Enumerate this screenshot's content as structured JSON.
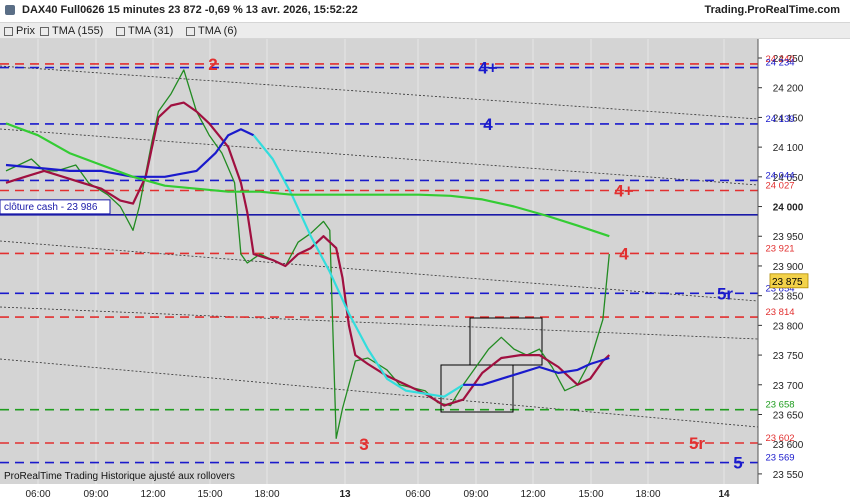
{
  "header": {
    "title": "DAX40 Full0626 15 minutes 23 872 -0,69 % 13 avr. 2026, 15:52:22",
    "brand": "Trading.ProRealTime.com"
  },
  "legend": [
    {
      "label": "Prix",
      "color": "#a0a0a0"
    },
    {
      "label": "TMA (155)",
      "color": "#33cc33"
    },
    {
      "label": "TMA (31)",
      "color": "#1a1acc"
    },
    {
      "label": "TMA (6)",
      "color": "#a01040"
    }
  ],
  "footer_note": "ProRealTime Trading  Historique ajusté aux rollovers",
  "chart_data": {
    "type": "line",
    "yticks": [
      23550,
      23600,
      23650,
      23700,
      23750,
      23800,
      23850,
      23900,
      23950,
      24000,
      24050,
      24100,
      24150,
      24200,
      24250
    ],
    "ylim": [
      23533,
      24282
    ],
    "xticks": [
      "06:00",
      "09:00",
      "12:00",
      "15:00",
      "18:00",
      "13",
      "06:00",
      "09:00",
      "12:00",
      "15:00",
      "18:00",
      "14"
    ],
    "close_value": "23 875",
    "cash_close": {
      "label": "clôture cash -  23 986",
      "value": 23986
    },
    "levels": [
      {
        "value": 24240,
        "label": "24 240",
        "color": "red",
        "tag": "2"
      },
      {
        "value": 24234,
        "label": "24 234",
        "color": "blue",
        "tag": "4+"
      },
      {
        "value": 24139,
        "label": "24 139",
        "color": "blue",
        "tag": "4"
      },
      {
        "value": 24044,
        "label": "24 044",
        "color": "blue",
        "tag": ""
      },
      {
        "value": 24027,
        "label": "24 027",
        "color": "red",
        "tag": "4+"
      },
      {
        "value": 23921,
        "label": "23 921",
        "color": "red",
        "tag": "4"
      },
      {
        "value": 23854,
        "label": "23 854",
        "color": "blue",
        "tag": "5r"
      },
      {
        "value": 23814,
        "label": "23 814",
        "color": "red",
        "tag": ""
      },
      {
        "value": 23658,
        "label": "23 658",
        "color": "green",
        "tag": ""
      },
      {
        "value": 23602,
        "label": "23 602",
        "color": "red",
        "tag": "5r"
      },
      {
        "value": 23569,
        "label": "23 569",
        "color": "blue",
        "tag": "5"
      }
    ],
    "pivots": [
      {
        "tag": "2",
        "value": 24240
      },
      {
        "tag": "3",
        "value": 23600
      }
    ],
    "series": [
      {
        "name": "Prix",
        "color": "#228b22",
        "points": [
          [
            0,
            24060
          ],
          [
            2,
            24070
          ],
          [
            4,
            24080
          ],
          [
            6,
            24060
          ],
          [
            8,
            24060
          ],
          [
            11,
            24070
          ],
          [
            13,
            24040
          ],
          [
            16,
            24020
          ],
          [
            18,
            24000
          ],
          [
            20,
            23960
          ],
          [
            21,
            24000
          ],
          [
            23,
            24110
          ],
          [
            24,
            24160
          ],
          [
            26,
            24190
          ],
          [
            28,
            24230
          ],
          [
            30,
            24160
          ],
          [
            32,
            24120
          ],
          [
            34,
            24090
          ],
          [
            36,
            24040
          ],
          [
            37,
            23920
          ],
          [
            38,
            23905
          ],
          [
            40,
            23920
          ],
          [
            42,
            23910
          ],
          [
            44,
            23900
          ],
          [
            46,
            23940
          ],
          [
            48,
            23955
          ],
          [
            50,
            23975
          ],
          [
            51,
            23960
          ],
          [
            52,
            23610
          ],
          [
            53,
            23660
          ],
          [
            55,
            23740
          ],
          [
            57,
            23745
          ],
          [
            60,
            23725
          ],
          [
            62,
            23700
          ],
          [
            64,
            23695
          ],
          [
            66,
            23690
          ],
          [
            68,
            23670
          ],
          [
            70,
            23665
          ],
          [
            72,
            23700
          ],
          [
            74,
            23730
          ],
          [
            76,
            23760
          ],
          [
            78,
            23780
          ],
          [
            80,
            23760
          ],
          [
            82,
            23750
          ],
          [
            84,
            23760
          ],
          [
            86,
            23730
          ],
          [
            88,
            23690
          ],
          [
            90,
            23700
          ],
          [
            92,
            23740
          ],
          [
            94,
            23810
          ],
          [
            95,
            23920
          ]
        ]
      },
      {
        "name": "TMA (6)",
        "color": "#a01040",
        "points": [
          [
            0,
            24040
          ],
          [
            3,
            24050
          ],
          [
            6,
            24060
          ],
          [
            9,
            24050
          ],
          [
            12,
            24040
          ],
          [
            15,
            24030
          ],
          [
            18,
            24010
          ],
          [
            20,
            24005
          ],
          [
            22,
            24050
          ],
          [
            24,
            24150
          ],
          [
            26,
            24170
          ],
          [
            28,
            24175
          ],
          [
            30,
            24160
          ],
          [
            32,
            24140
          ],
          [
            35,
            24100
          ],
          [
            37,
            24040
          ],
          [
            38,
            23990
          ],
          [
            39,
            23920
          ],
          [
            42,
            23910
          ],
          [
            44,
            23900
          ],
          [
            46,
            23920
          ],
          [
            48,
            23930
          ],
          [
            50,
            23950
          ],
          [
            52,
            23930
          ],
          [
            53,
            23880
          ],
          [
            54,
            23800
          ],
          [
            55,
            23750
          ],
          [
            57,
            23735
          ],
          [
            60,
            23715
          ],
          [
            63,
            23700
          ],
          [
            66,
            23685
          ],
          [
            69,
            23665
          ],
          [
            72,
            23675
          ],
          [
            75,
            23720
          ],
          [
            78,
            23745
          ],
          [
            81,
            23750
          ],
          [
            84,
            23750
          ],
          [
            87,
            23730
          ],
          [
            90,
            23700
          ],
          [
            92,
            23710
          ],
          [
            94,
            23740
          ],
          [
            95,
            23750
          ]
        ]
      },
      {
        "name": "TMA (31)",
        "color": "#1a1acc",
        "points": [
          [
            0,
            24070
          ],
          [
            5,
            24065
          ],
          [
            10,
            24060
          ],
          [
            15,
            24060
          ],
          [
            20,
            24050
          ],
          [
            25,
            24050
          ],
          [
            30,
            24060
          ],
          [
            33,
            24090
          ],
          [
            35,
            24120
          ],
          [
            37,
            24130
          ],
          [
            39,
            24120
          ]
        ]
      },
      {
        "name": "TMA (31) cyan",
        "color": "#33dddd",
        "points": [
          [
            39,
            24120
          ],
          [
            42,
            24080
          ],
          [
            45,
            24020
          ],
          [
            48,
            23950
          ],
          [
            51,
            23890
          ],
          [
            54,
            23820
          ],
          [
            57,
            23760
          ],
          [
            60,
            23710
          ],
          [
            63,
            23690
          ],
          [
            66,
            23685
          ],
          [
            69,
            23680
          ],
          [
            72,
            23700
          ]
        ]
      },
      {
        "name": "TMA (31) blue",
        "color": "#1a1acc",
        "points": [
          [
            72,
            23700
          ],
          [
            75,
            23700
          ],
          [
            78,
            23710
          ],
          [
            81,
            23720
          ],
          [
            84,
            23730
          ],
          [
            87,
            23720
          ],
          [
            90,
            23725
          ],
          [
            92,
            23735
          ],
          [
            95,
            23745
          ]
        ]
      },
      {
        "name": "TMA (155)",
        "color": "#33cc33",
        "points": [
          [
            0,
            24140
          ],
          [
            5,
            24120
          ],
          [
            10,
            24090
          ],
          [
            15,
            24070
          ],
          [
            20,
            24050
          ],
          [
            25,
            24035
          ],
          [
            30,
            24030
          ],
          [
            35,
            24025
          ],
          [
            40,
            24025
          ],
          [
            45,
            24020
          ],
          [
            50,
            24020
          ],
          [
            55,
            24020
          ],
          [
            60,
            24020
          ],
          [
            65,
            24020
          ],
          [
            70,
            24018
          ],
          [
            75,
            24012
          ],
          [
            80,
            24000
          ],
          [
            85,
            23985
          ],
          [
            90,
            23968
          ],
          [
            95,
            23950
          ]
        ]
      }
    ]
  }
}
